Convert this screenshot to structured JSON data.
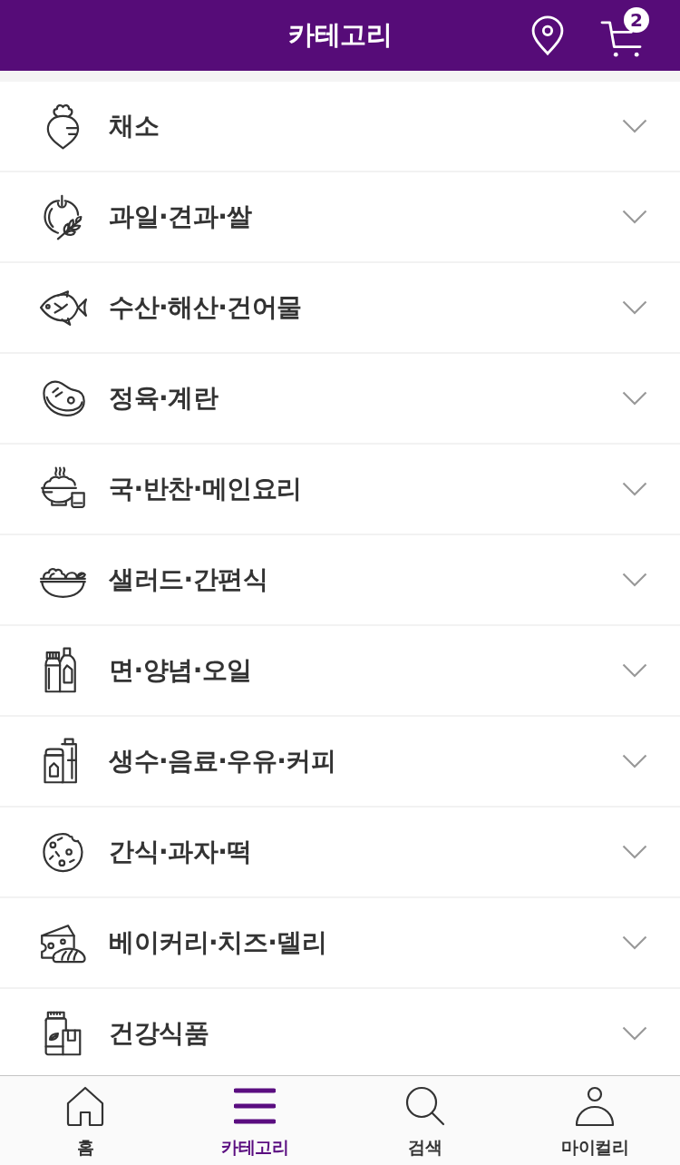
{
  "header": {
    "title": "카테고리",
    "cart_count": "2"
  },
  "categories": [
    {
      "label": "채소",
      "expanded": false
    },
    {
      "label": "과일·견과·쌀",
      "expanded": false
    },
    {
      "label": "수산·해산·건어물",
      "expanded": false
    },
    {
      "label": "정육·계란",
      "expanded": false
    },
    {
      "label": "국·반찬·메인요리",
      "expanded": false
    },
    {
      "label": "샐러드·간편식",
      "expanded": false
    },
    {
      "label": "면·양념·오일",
      "expanded": false
    },
    {
      "label": "생수·음료·우유·커피",
      "expanded": false
    },
    {
      "label": "간식·과자·떡",
      "expanded": false
    },
    {
      "label": "베이커리·치즈·델리",
      "expanded": false
    },
    {
      "label": "건강식품",
      "expanded": false
    }
  ],
  "nav": [
    {
      "label": "홈",
      "selected": false
    },
    {
      "label": "카테고리",
      "selected": true
    },
    {
      "label": "검색",
      "selected": false
    },
    {
      "label": "마이컬리",
      "selected": false
    }
  ]
}
